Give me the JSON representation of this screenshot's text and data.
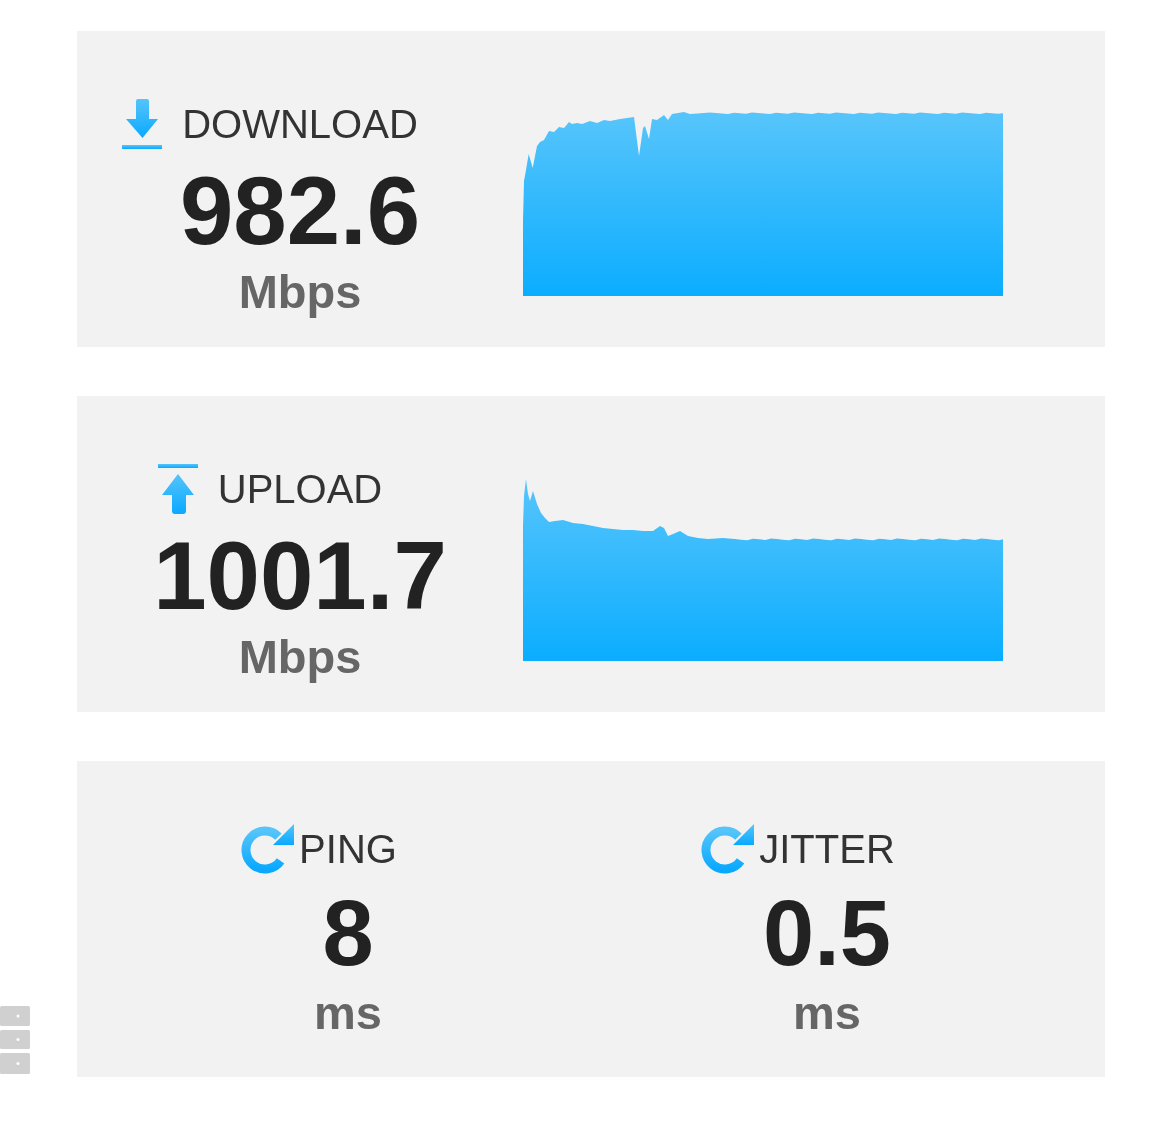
{
  "results": [
    {
      "kind": "download",
      "label": "DOWNLOAD",
      "value": "982.6",
      "unit": "Mbps"
    },
    {
      "kind": "upload",
      "label": "UPLOAD",
      "value": "1001.7",
      "unit": "Mbps"
    }
  ],
  "latency": [
    {
      "label": "PING",
      "value": "8",
      "unit": "ms"
    },
    {
      "label": "JITTER",
      "value": "0.5",
      "unit": "ms"
    }
  ]
}
